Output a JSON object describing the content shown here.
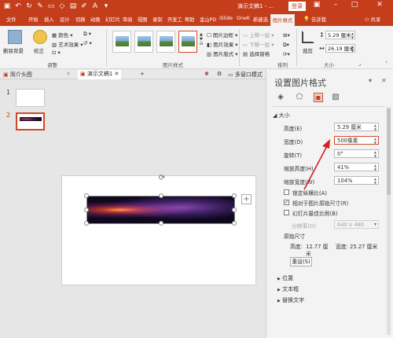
{
  "titlebar": {
    "qa_icons": [
      "save-icon",
      "undo-icon",
      "redo-icon",
      "paste-format-icon",
      "start-presentation-icon",
      "shape-icon",
      "picture-icon",
      "pen-icon",
      "text-icon",
      "dropdown-icon"
    ],
    "doc_title": "演示文稿1 - ...",
    "login": "登录"
  },
  "tabs": [
    "文件",
    "开始",
    "插入",
    "设计",
    "切换",
    "动画",
    "幻灯片",
    "审阅",
    "视图",
    "录制",
    "开发工",
    "帮助",
    "金山PD",
    "iSlide",
    "OneK",
    "新建选",
    "图片格式",
    "告诉我",
    "共享"
  ],
  "active_tab": "图片格式",
  "ribbon": {
    "remove_bg": "删除背景",
    "correct": "校正",
    "color": "颜色",
    "artistic": "艺术效果",
    "adjust_group": "调整",
    "styles_group": "图片样式",
    "pic_border": "图片边框",
    "pic_effect": "图片效果",
    "pic_layout": "图片版式",
    "bring_forward": "上移一层",
    "send_backward": "下移一层",
    "selection_pane": "选择窗格",
    "arrange_group": "排列",
    "crop": "裁剪",
    "size_group": "大小",
    "height_value": "5.29 厘米",
    "width_value": "26.19 厘米"
  },
  "doctabs": {
    "tab1": "简介头图",
    "tab2": "演示文稿1",
    "tab3": "多窗口模式"
  },
  "slides": [
    "1",
    "2"
  ],
  "pane": {
    "title": "设置图片格式",
    "size_section": "大小",
    "height_label": "高度(E)",
    "height_value": "5.29 厘米",
    "width_label": "宽度(D)",
    "width_value": "500像素",
    "rotate_label": "旋转(T)",
    "rotate_value": "0°",
    "scale_h_label": "缩放高度(H)",
    "scale_h_value": "41%",
    "scale_w_label": "缩放宽度(W)",
    "scale_w_value": "104%",
    "lock_aspect": "锁定纵横比(A)",
    "relative_size": "相对于图片原始尺寸(R)",
    "best_scale": "幻灯片最佳比例(B)",
    "resolution_label": "分辨率(O)",
    "resolution_value": "640 x 480",
    "orig_size": "原始尺寸",
    "orig_height_label": "高度:",
    "orig_height_value": "12.77 厘",
    "orig_height_unit": "米",
    "orig_width": "宽度: 25.27 厘米",
    "reset": "重设(S)",
    "position": "位置",
    "textbox": "文本框",
    "alt_text": "替换文字"
  },
  "colors": {
    "brand": "#c43e1c",
    "accent": "#d24726"
  }
}
